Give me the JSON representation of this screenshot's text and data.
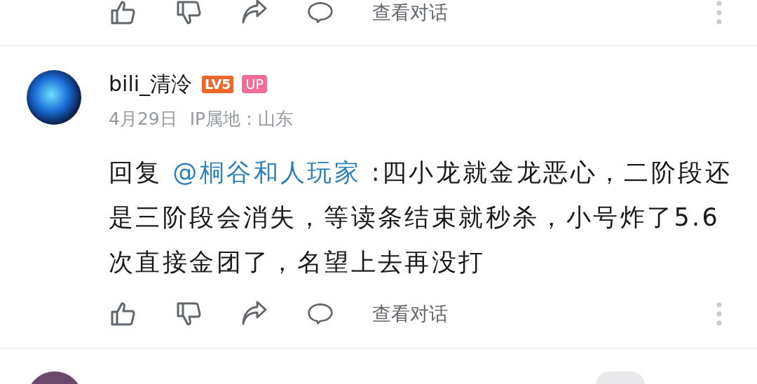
{
  "previous_comment": {
    "view_conversation": "查看对话"
  },
  "comment": {
    "username": "bili_清泠",
    "level_badge": "LV5",
    "up_badge": "UP",
    "date": "4月29日",
    "ip_location": "IP属地：山东",
    "reply_prefix": "回复",
    "mention": "@桐谷和人玩家",
    "text": ":四小龙就金龙恶心，二阶段还是三阶段会消失，等读条结束就秒杀，小号炸了5.6次直接金团了，名望上去再没打",
    "view_conversation": "查看对话"
  }
}
